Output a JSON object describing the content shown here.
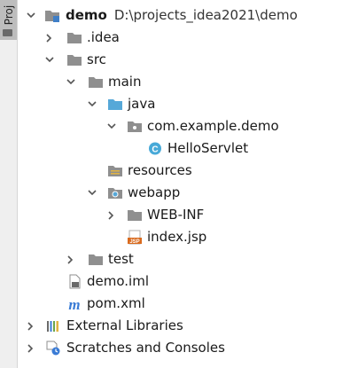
{
  "sidebar": {
    "tab_label": "Proj"
  },
  "tree": {
    "root": {
      "name": "demo",
      "path": "D:\\projects_idea2021\\demo"
    },
    "items": [
      {
        "label": ".idea"
      },
      {
        "label": "src"
      },
      {
        "label": "main"
      },
      {
        "label": "java"
      },
      {
        "label": "com.example.demo"
      },
      {
        "label": "HelloServlet"
      },
      {
        "label": "resources"
      },
      {
        "label": "webapp"
      },
      {
        "label": "WEB-INF"
      },
      {
        "label": "index.jsp"
      },
      {
        "label": "test"
      },
      {
        "label": "demo.iml"
      },
      {
        "label": "pom.xml"
      },
      {
        "label": "External Libraries"
      },
      {
        "label": "Scratches and Consoles"
      }
    ]
  },
  "colors": {
    "folder": "#8f8f8f",
    "source_folder": "#56a8d8",
    "class_icon": "#47a9d8",
    "jsp_icon": "#d96a1e",
    "maven_icon": "#3a7bd5"
  },
  "icons": {
    "module": "module-folder-icon",
    "folder": "folder-icon",
    "source": "source-root-icon",
    "package": "package-icon",
    "class": "java-class-icon",
    "resources": "resources-root-icon",
    "web": "web-folder-icon",
    "jsp": "jsp-file-icon",
    "iml": "iml-file-icon",
    "maven": "maven-pom-icon",
    "libraries": "libraries-icon",
    "scratches": "scratches-icon"
  }
}
